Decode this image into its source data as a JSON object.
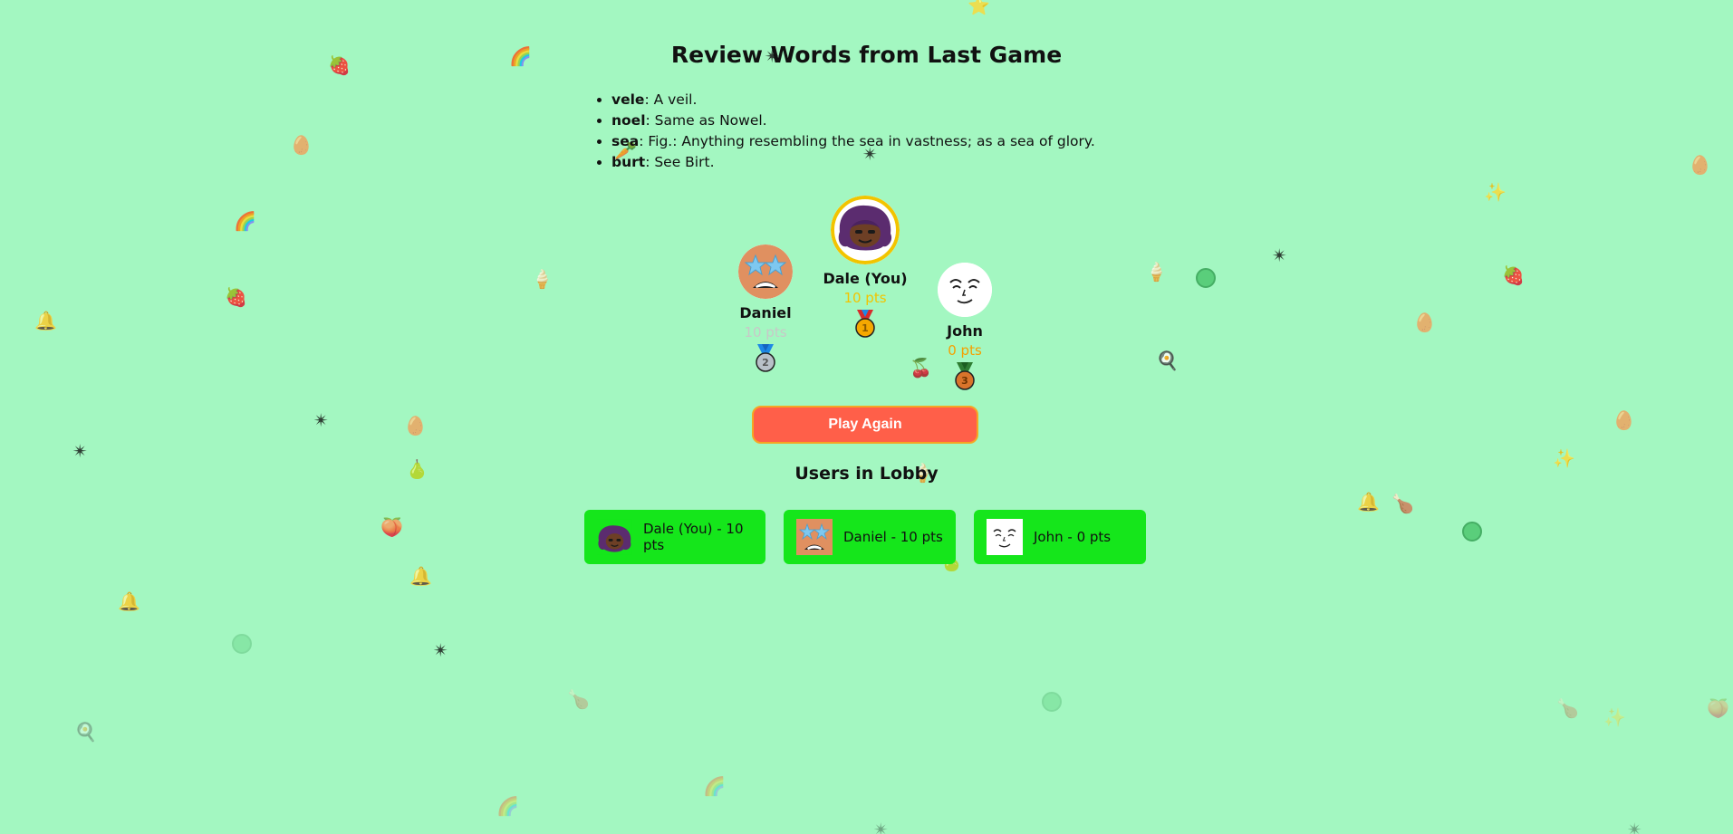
{
  "review": {
    "title": "Review Words from Last Game",
    "words": [
      {
        "word": "vele",
        "definition": ": A veil."
      },
      {
        "word": "noel",
        "definition": ": Same as Nowel."
      },
      {
        "word": "sea",
        "definition": ": Fig.: Anything resembling the sea in vastness; as a sea of glory."
      },
      {
        "word": "burt",
        "definition": ": See Birt."
      }
    ]
  },
  "podium": {
    "first": {
      "name": "Dale (You)",
      "points": "10 pts",
      "rank": "1",
      "color": "#f2c400"
    },
    "second": {
      "name": "Daniel",
      "points": "10 pts",
      "rank": "2",
      "color": "#c8c8c8"
    },
    "third": {
      "name": "John",
      "points": "0 pts",
      "rank": "3",
      "color": "#f5a000"
    }
  },
  "play_again_label": "Play Again",
  "lobby": {
    "title": "Users in Lobby",
    "users": [
      {
        "label": "Dale (You) - 10 pts"
      },
      {
        "label": "Daniel - 10 pts"
      },
      {
        "label": "John - 0 pts"
      }
    ]
  },
  "colors": {
    "background": "#a3f7c1",
    "button": "#ff5f49",
    "button_border": "#f5a623",
    "lobby_card": "#15e61b"
  }
}
